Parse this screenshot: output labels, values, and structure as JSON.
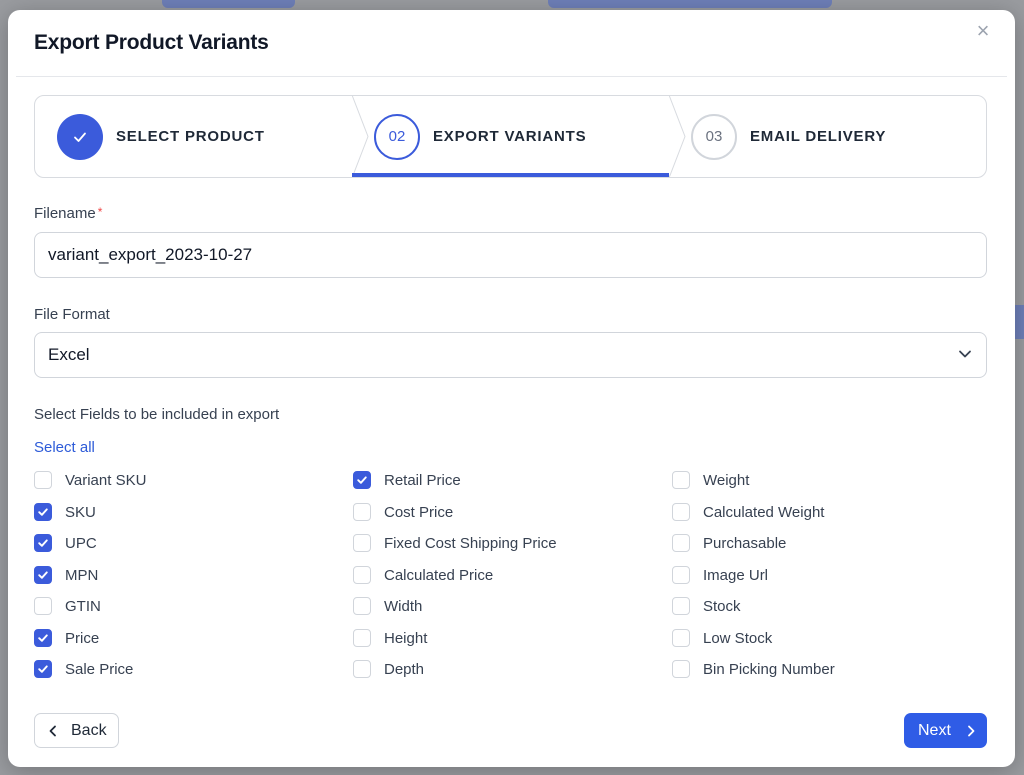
{
  "modal": {
    "title": "Export Product Variants",
    "close_glyph": "×"
  },
  "stepper": {
    "steps": [
      {
        "number": "",
        "label": "SELECT PRODUCT",
        "state": "completed",
        "icon": "check-icon"
      },
      {
        "number": "02",
        "label": "EXPORT VARIANTS",
        "state": "active"
      },
      {
        "number": "03",
        "label": "EMAIL DELIVERY",
        "state": "upcoming"
      }
    ]
  },
  "form": {
    "filename_label": "Filename",
    "required_mark": "*",
    "filename_value": "variant_export_2023-10-27",
    "format_label": "File Format",
    "format_value": "Excel",
    "fields_label": "Select Fields to be included in export",
    "select_all_label": "Select all"
  },
  "fields": {
    "col1": [
      {
        "label": "Variant SKU",
        "checked": false
      },
      {
        "label": "SKU",
        "checked": true
      },
      {
        "label": "UPC",
        "checked": true
      },
      {
        "label": "MPN",
        "checked": true
      },
      {
        "label": "GTIN",
        "checked": false
      },
      {
        "label": "Price",
        "checked": true
      },
      {
        "label": "Sale Price",
        "checked": true
      }
    ],
    "col2": [
      {
        "label": "Retail Price",
        "checked": true
      },
      {
        "label": "Cost Price",
        "checked": false
      },
      {
        "label": "Fixed Cost Shipping Price",
        "checked": false
      },
      {
        "label": "Calculated Price",
        "checked": false
      },
      {
        "label": "Width",
        "checked": false
      },
      {
        "label": "Height",
        "checked": false
      },
      {
        "label": "Depth",
        "checked": false
      }
    ],
    "col3": [
      {
        "label": "Weight",
        "checked": false
      },
      {
        "label": "Calculated Weight",
        "checked": false
      },
      {
        "label": "Purchasable",
        "checked": false
      },
      {
        "label": "Image Url",
        "checked": false
      },
      {
        "label": "Stock",
        "checked": false
      },
      {
        "label": "Low Stock",
        "checked": false
      },
      {
        "label": "Bin Picking Number",
        "checked": false
      }
    ]
  },
  "footer": {
    "back_label": "Back",
    "next_label": "Next"
  },
  "colors": {
    "accent": "#3b5bdb",
    "next_button": "#2f5ce6",
    "link": "#2d5bd8",
    "required": "#ef4444"
  }
}
